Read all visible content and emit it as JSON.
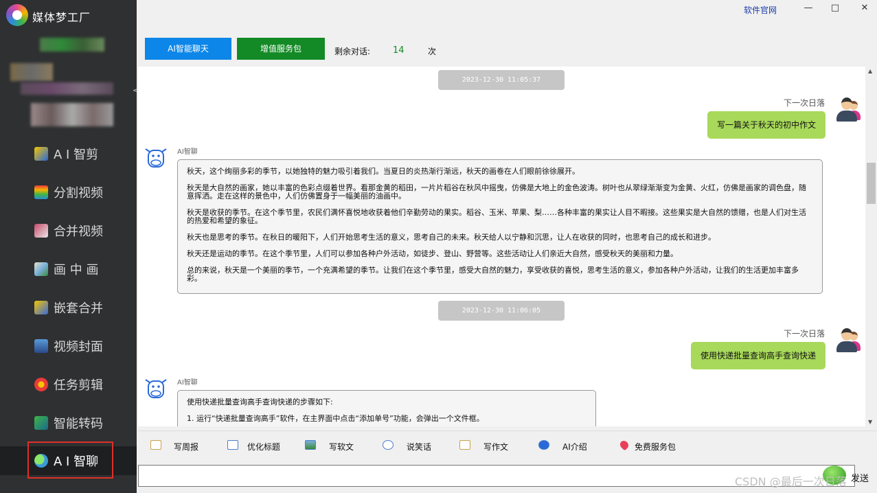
{
  "app": {
    "name": "媒体梦工厂"
  },
  "window": {
    "official_link": "软件官网",
    "min": "—",
    "max": "□",
    "close": "✕"
  },
  "sidebar": {
    "collapse": "<",
    "items": [
      {
        "label": "A I 智剪"
      },
      {
        "label": "分割视频"
      },
      {
        "label": "合并视频"
      },
      {
        "label": "画 中 画"
      },
      {
        "label": "嵌套合并"
      },
      {
        "label": "视频封面"
      },
      {
        "label": "任务剪辑"
      },
      {
        "label": "智能转码"
      },
      {
        "label": "A I 智聊"
      }
    ]
  },
  "top": {
    "ai_chat_button": "AI智能聊天",
    "service_pack_button": "增值服务包",
    "remaining_label": "剩余对话:",
    "remaining_count": "14",
    "remaining_unit": "次"
  },
  "chat": {
    "messages": [
      {
        "timestamp": "2023-12-30 11:05:37",
        "user": "下一次日落",
        "question": "写一篇关于秋天的初中作文",
        "bot": "AI智聊",
        "answer": [
          "秋天，这个绚丽多彩的季节，以她独特的魅力吸引着我们。当夏日的炎热渐行渐远，秋天的画卷在人们眼前徐徐展开。",
          "秋天是大自然的画家，她以丰富的色彩点缀着世界。看那金黄的稻田，一片片稻谷在秋风中摇曳，仿佛是大地上的金色波涛。树叶也从翠绿渐渐变为金黄、火红，仿佛是画家的调色盘，随意挥洒。走在这样的景色中，人们仿佛置身于一幅美丽的油画中。",
          "秋天是收获的季节。在这个季节里，农民们满怀喜悦地收获着他们辛勤劳动的果实。稻谷、玉米、苹果、梨……各种丰富的果实让人目不暇接。这些果实是大自然的馈赠，也是人们对生活的热爱和希望的象征。",
          "秋天也是思考的季节。在秋日的暖阳下，人们开始思考生活的意义，思考自己的未来。秋天给人以宁静和沉思，让人在收获的同时，也思考自己的成长和进步。",
          "秋天还是运动的季节。在这个季节里，人们可以参加各种户外活动，如徒步、登山、野营等。这些活动让人们亲近大自然，感受秋天的美丽和力量。",
          "总的来说，秋天是一个美丽的季节，一个充满希望的季节。让我们在这个季节里，感受大自然的魅力，享受收获的喜悦，思考生活的意义，参加各种户外活动，让我们的生活更加丰富多彩。"
        ]
      },
      {
        "timestamp": "2023-12-30 11:06:05",
        "user": "下一次日落",
        "question": "使用快递批量查询高手查询快递",
        "bot": "AI智聊",
        "answer": [
          "使用快递批量查询高手查询快递的步骤如下:",
          "1.  运行“快递批量查询高手”软件，在主界面中点击“添加单号”功能，会弹出一个文件框。"
        ]
      }
    ]
  },
  "toolbar": {
    "items": [
      {
        "label": "写周报",
        "icon": "pencil-note-icon"
      },
      {
        "label": "优化标题",
        "icon": "window-icon"
      },
      {
        "label": "写软文",
        "icon": "picture-icon"
      },
      {
        "label": "说笑话",
        "icon": "speech-bubble-icon"
      },
      {
        "label": "写作文",
        "icon": "pen-icon"
      },
      {
        "label": "AI介绍",
        "icon": "info-icon"
      },
      {
        "label": "免费服务包",
        "icon": "heart-icon"
      }
    ]
  },
  "input": {
    "send_label": "发送"
  },
  "watermark": "CSDN @最后一次日落",
  "colors": {
    "sidebar_bg": "#2e3031",
    "ai_button": "#0c86e8",
    "pkg_button": "#138a25",
    "user_bubble": "#a8d95a",
    "highlight": "#e0302a"
  }
}
